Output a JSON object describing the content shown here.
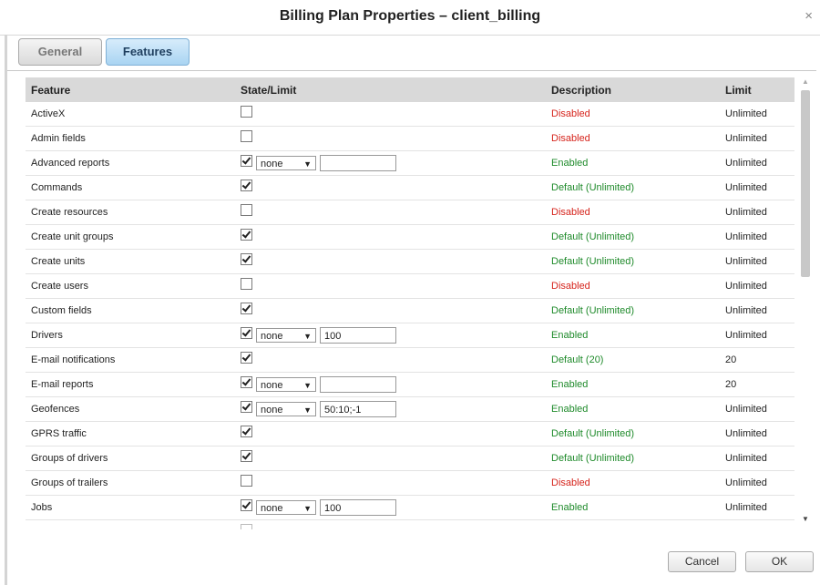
{
  "window": {
    "title": "Billing Plan Properties – client_billing",
    "close_glyph": "×"
  },
  "tabs": [
    {
      "label": "General",
      "active": false
    },
    {
      "label": "Features",
      "active": true
    }
  ],
  "table": {
    "headers": [
      "Feature",
      "State/Limit",
      "Description",
      "Limit"
    ],
    "rows": [
      {
        "feature": "ActiveX",
        "checked": false,
        "has_select": false,
        "description": "Disabled",
        "status": "disabled",
        "limit": "Unlimited"
      },
      {
        "feature": "Admin fields",
        "checked": false,
        "has_select": false,
        "description": "Disabled",
        "status": "disabled",
        "limit": "Unlimited"
      },
      {
        "feature": "Advanced reports",
        "checked": true,
        "has_select": true,
        "select": "none",
        "input": "",
        "description": "Enabled",
        "status": "enabled",
        "limit": "Unlimited"
      },
      {
        "feature": "Commands",
        "checked": true,
        "has_select": false,
        "description": "Default (Unlimited)",
        "status": "enabled",
        "limit": "Unlimited"
      },
      {
        "feature": "Create resources",
        "checked": false,
        "has_select": false,
        "description": "Disabled",
        "status": "disabled",
        "limit": "Unlimited"
      },
      {
        "feature": "Create unit groups",
        "checked": true,
        "has_select": false,
        "description": "Default (Unlimited)",
        "status": "enabled",
        "limit": "Unlimited"
      },
      {
        "feature": "Create units",
        "checked": true,
        "has_select": false,
        "description": "Default (Unlimited)",
        "status": "enabled",
        "limit": "Unlimited"
      },
      {
        "feature": "Create users",
        "checked": false,
        "has_select": false,
        "description": "Disabled",
        "status": "disabled",
        "limit": "Unlimited"
      },
      {
        "feature": "Custom fields",
        "checked": true,
        "has_select": false,
        "description": "Default (Unlimited)",
        "status": "enabled",
        "limit": "Unlimited"
      },
      {
        "feature": "Drivers",
        "checked": true,
        "has_select": true,
        "select": "none",
        "input": "100",
        "description": "Enabled",
        "status": "enabled",
        "limit": "Unlimited"
      },
      {
        "feature": "E-mail notifications",
        "checked": true,
        "has_select": false,
        "description": "Default (20)",
        "status": "enabled",
        "limit": "20"
      },
      {
        "feature": "E-mail reports",
        "checked": true,
        "has_select": true,
        "select": "none",
        "input": "",
        "description": "Enabled",
        "status": "enabled",
        "limit": "20"
      },
      {
        "feature": "Geofences",
        "checked": true,
        "has_select": true,
        "select": "none",
        "input": "50:10;-1",
        "description": "Enabled",
        "status": "enabled",
        "limit": "Unlimited"
      },
      {
        "feature": "GPRS traffic",
        "checked": true,
        "has_select": false,
        "description": "Default (Unlimited)",
        "status": "enabled",
        "limit": "Unlimited"
      },
      {
        "feature": "Groups of drivers",
        "checked": true,
        "has_select": false,
        "description": "Default (Unlimited)",
        "status": "enabled",
        "limit": "Unlimited"
      },
      {
        "feature": "Groups of trailers",
        "checked": false,
        "has_select": false,
        "description": "Disabled",
        "status": "disabled",
        "limit": "Unlimited"
      },
      {
        "feature": "Jobs",
        "checked": true,
        "has_select": true,
        "select": "none",
        "input": "100",
        "description": "Enabled",
        "status": "enabled",
        "limit": "Unlimited"
      },
      {
        "feature": "",
        "checked": false,
        "has_select": false,
        "description": "",
        "status": "disabled",
        "limit": ""
      }
    ]
  },
  "scrollbar": {
    "up_icon": "▲",
    "down_icon": "▼"
  },
  "select_arrow": "▼",
  "buttons": {
    "cancel": "Cancel",
    "ok": "OK"
  },
  "colors": {
    "disabled": "#d6241c",
    "enabled": "#1e8a2a",
    "active_tab": "#a9d4f2"
  }
}
